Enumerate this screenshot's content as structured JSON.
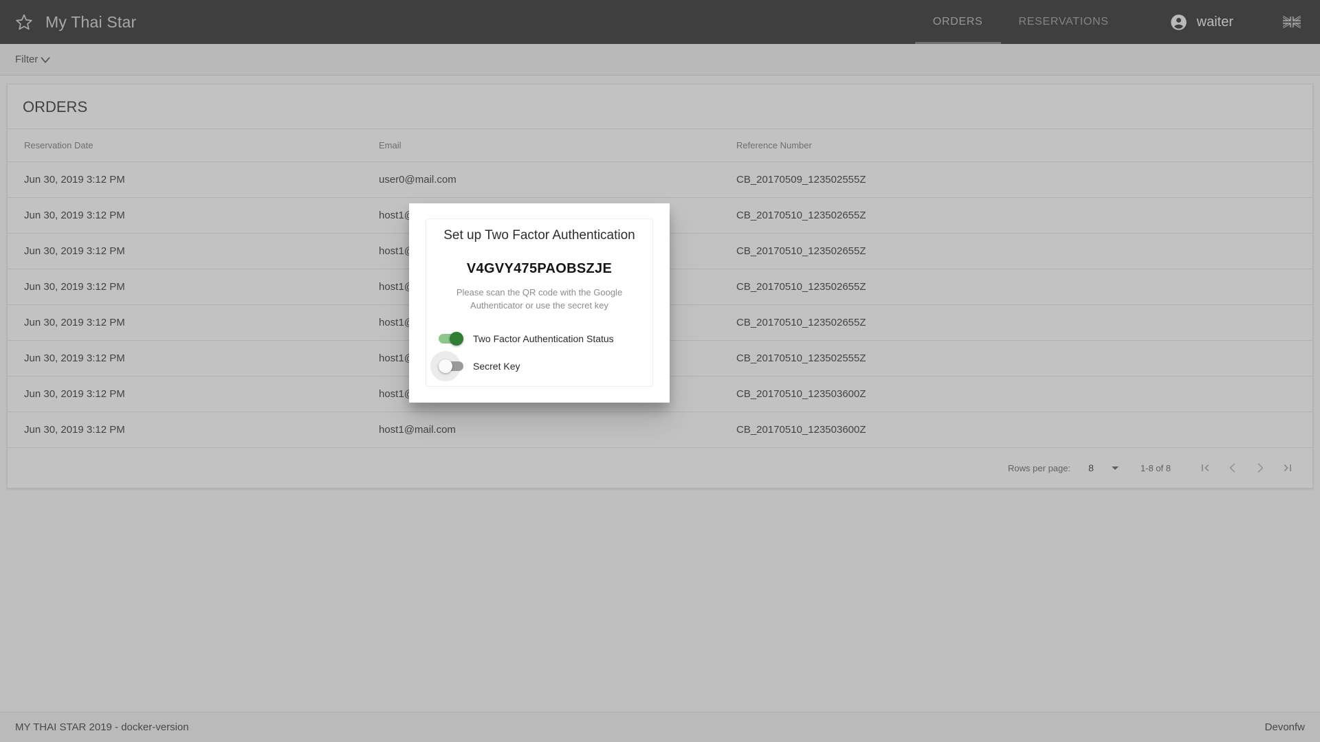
{
  "toolbar": {
    "brand_title": "My Thai Star",
    "star_icon": "star-outline-icon",
    "tabs": [
      {
        "label": "ORDERS",
        "active": true
      },
      {
        "label": "RESERVATIONS",
        "active": false
      }
    ],
    "user_name": "waiter",
    "user_icon": "account-circle-icon",
    "language_flag": "uk-flag-icon"
  },
  "filter": {
    "label": "Filter",
    "chevron_icon": "chevron-down-icon"
  },
  "orders": {
    "title": "ORDERS",
    "columns": [
      "Reservation Date",
      "Email",
      "Reference Number"
    ],
    "rows": [
      {
        "date": "Jun 30, 2019 3:12 PM",
        "email": "user0@mail.com",
        "reference": "CB_20170509_123502555Z"
      },
      {
        "date": "Jun 30, 2019 3:12 PM",
        "email": "host1@mail.com",
        "reference": "CB_20170510_123502655Z"
      },
      {
        "date": "Jun 30, 2019 3:12 PM",
        "email": "host1@mail.com",
        "reference": "CB_20170510_123502655Z"
      },
      {
        "date": "Jun 30, 2019 3:12 PM",
        "email": "host1@mail.com",
        "reference": "CB_20170510_123502655Z"
      },
      {
        "date": "Jun 30, 2019 3:12 PM",
        "email": "host1@mail.com",
        "reference": "CB_20170510_123502655Z"
      },
      {
        "date": "Jun 30, 2019 3:12 PM",
        "email": "host1@mail.com",
        "reference": "CB_20170510_123502555Z"
      },
      {
        "date": "Jun 30, 2019 3:12 PM",
        "email": "host1@mail.com",
        "reference": "CB_20170510_123503600Z"
      },
      {
        "date": "Jun 30, 2019 3:12 PM",
        "email": "host1@mail.com",
        "reference": "CB_20170510_123503600Z"
      }
    ]
  },
  "paginator": {
    "rows_per_page_label": "Rows per page:",
    "rows_per_page_value": "8",
    "range_label": "1-8 of 8",
    "first_icon": "first-page-icon",
    "prev_icon": "chevron-left-icon",
    "next_icon": "chevron-right-icon",
    "last_icon": "last-page-icon"
  },
  "footer": {
    "left": "MY THAI STAR 2019 - docker-version",
    "right": "Devonfw"
  },
  "modal": {
    "title": "Set up Two Factor Authentication",
    "secret_key": "V4GVY475PAOBSZJE",
    "help_text": "Please scan the QR code with the Google Authenticator or use the secret key",
    "toggles": [
      {
        "label": "Two Factor Authentication Status",
        "state": "on"
      },
      {
        "label": "Secret Key",
        "state": "off"
      }
    ]
  },
  "colors": {
    "toolbar_bg": "#2b1b18",
    "toggle_on": "#2e7d32",
    "toggle_off": "#9a9a9a",
    "accent_text": "#d9cfcc"
  }
}
